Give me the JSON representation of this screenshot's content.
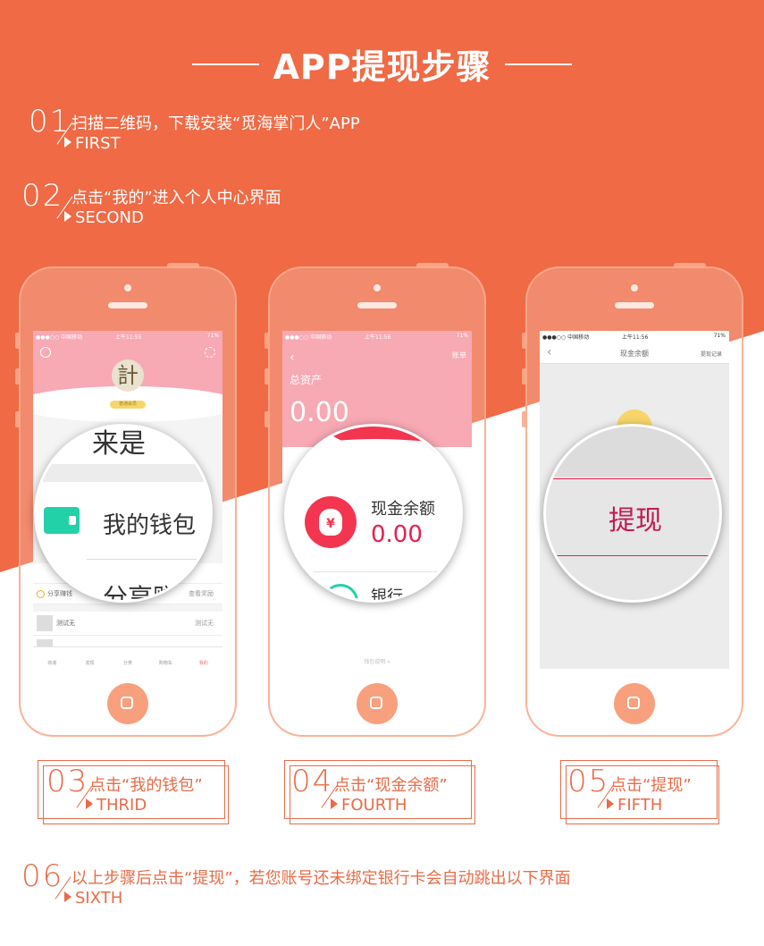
{
  "title": "APP提现步骤",
  "steps": {
    "s1": {
      "num": "01",
      "text": "扫描二维码，下载安装“觅海掌门人”APP",
      "sub": "FIRST"
    },
    "s2": {
      "num": "02",
      "text": "点击“我的”进入个人中心界面",
      "sub": "SECOND"
    },
    "s3": {
      "num": "03",
      "text": "点击“我的钱包”",
      "sub": "THRID"
    },
    "s4": {
      "num": "04",
      "text": "点击“现金余额”",
      "sub": "FOURTH"
    },
    "s5": {
      "num": "05",
      "text": "点击“提现”",
      "sub": "FIFTH"
    },
    "s6": {
      "num": "06",
      "text": "以上步骤后点击“提现”，若您账号还未绑定银行卡会自动跳出以下界面",
      "sub": "SIXTH"
    }
  },
  "phone1": {
    "carrier": "●●●○○ 中国移动",
    "time": "上午11:55",
    "battery": "71%",
    "avatar_char": "計",
    "badge": "普通会员",
    "menu_top": "来是",
    "wallet_label": "我的钱包",
    "menu_next": "分享赚",
    "row_share": "分享赚钱",
    "row_share_right": "查看奖励",
    "row_test1": "测试无",
    "row_test1_right": "测试无",
    "tabbar": [
      "商城",
      "发现",
      "分类",
      "购物车",
      "我的"
    ]
  },
  "phone2": {
    "carrier": "●●●○○ 中国移动",
    "time": "上午11:56",
    "battery": "71%",
    "bill": "账单",
    "total_label": "总资产",
    "total_value": "0.00",
    "cash_label": "现金余额",
    "cash_value": "0.00",
    "cash_icon": "¥",
    "next_row": "银行",
    "footer": "钱包说明 »"
  },
  "phone3": {
    "carrier": "●●●○○ 中国移动",
    "time": "上午11:56",
    "battery": "71%",
    "nav_title": "现金余额",
    "nav_right": "提现记录",
    "withdraw_label": "提现"
  },
  "colors": {
    "orange": "#ef6a45",
    "pink": "#f7a9b4",
    "red_accent": "#e6204f",
    "teal": "#22d1a8"
  }
}
